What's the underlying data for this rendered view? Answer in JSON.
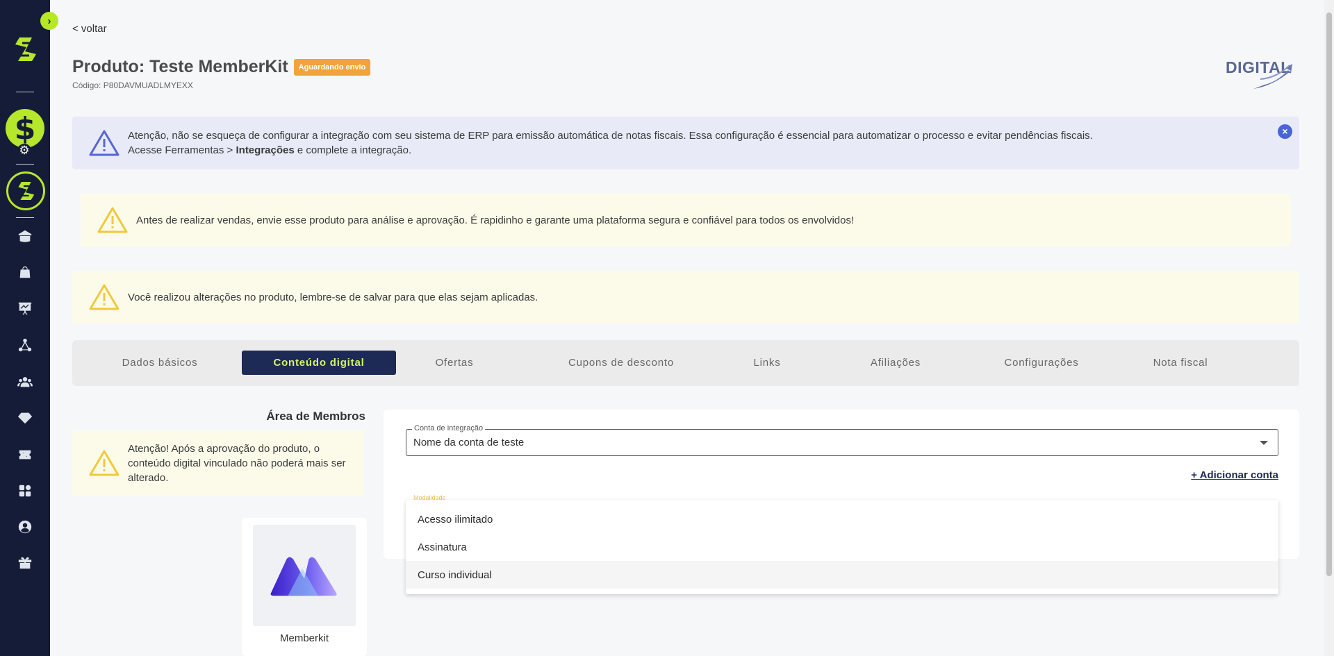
{
  "sidebar": {
    "toggle_icon": "chevron-right-icon",
    "logo": "brand-s-logo",
    "items": [
      {
        "name": "dashboard-icon"
      },
      {
        "name": "shopping-bag-icon"
      },
      {
        "name": "presentation-chart-icon"
      },
      {
        "name": "network-icon"
      },
      {
        "name": "users-icon"
      },
      {
        "name": "diamond-icon"
      },
      {
        "name": "coupon-icon"
      },
      {
        "name": "apps-grid-icon"
      },
      {
        "name": "account-circle-icon"
      },
      {
        "name": "gift-icon"
      }
    ],
    "accent": "#b6e72a",
    "bg": "#151c38"
  },
  "header": {
    "back": "< voltar",
    "title": "Produto: Teste MemberKit",
    "status_badge": "Aguardando envio",
    "code": "Código: P80DAVMUADLMYEXX",
    "brand": "DIGITAL"
  },
  "alerts": {
    "erp": {
      "line1": "Atenção, não se esqueça de configurar a integração com seu sistema de ERP para emissão automática de notas fiscais. Essa configuração é essencial para automatizar o processo e evitar pendências fiscais.",
      "line2_pre": "Acesse Ferramentas > ",
      "line2_bold": "Integrações",
      "line2_post": " e complete a integração."
    },
    "approval": "Antes de realizar vendas, envie esse produto para análise e aprovação. É rapidinho e garante uma plataforma segura e confiável para todos os envolvidos!",
    "unsaved": "Você realizou alterações no produto, lembre-se de salvar para que elas sejam aplicadas."
  },
  "tabs": [
    {
      "label": "Dados básicos"
    },
    {
      "label": "Conteúdo digital"
    },
    {
      "label": "Ofertas"
    },
    {
      "label": "Cupons de desconto"
    },
    {
      "label": "Links"
    },
    {
      "label": "Afiliações"
    },
    {
      "label": "Configurações"
    },
    {
      "label": "Nota fiscal"
    }
  ],
  "active_tab": "Conteúdo digital",
  "members_area": {
    "title": "Área de Membros",
    "warning": "Atenção! Após a aprovação do produto, o conteúdo digital vinculado não poderá mais ser alterado.",
    "platform": "Memberkit"
  },
  "integration": {
    "account_label": "Conta de integração",
    "account_value": "Nome da conta de teste",
    "add_account": "+ Adicionar conta",
    "modality_label": "Modalidade",
    "modality_options": [
      "Acesso ilimitado",
      "Assinatura",
      "Curso individual"
    ],
    "highlighted_option": "Curso individual"
  }
}
